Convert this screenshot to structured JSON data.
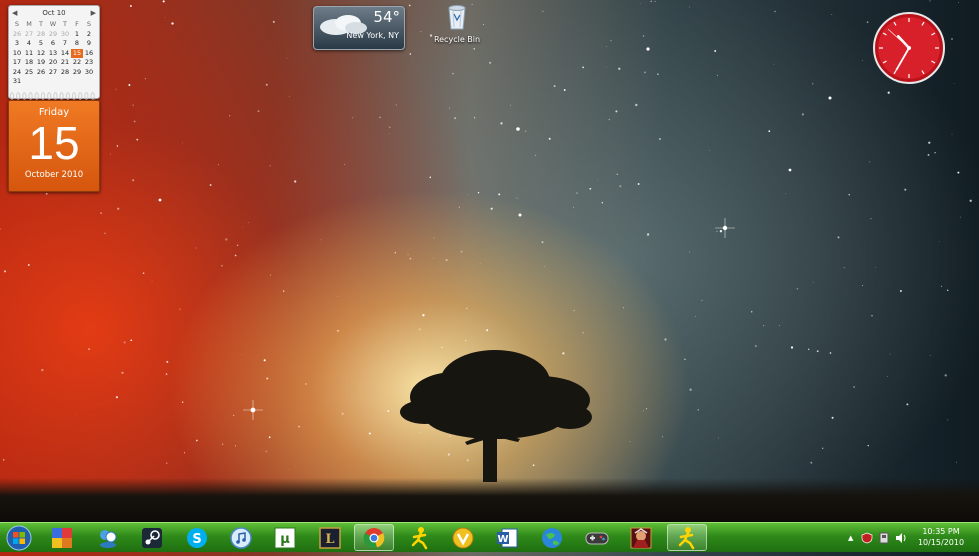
{
  "calendar": {
    "month_label": "Oct 10",
    "prev_label": "◀",
    "next_label": "▶",
    "weekdays": [
      "S",
      "M",
      "T",
      "W",
      "T",
      "F",
      "S"
    ],
    "rows": [
      [
        "26",
        "27",
        "28",
        "29",
        "30",
        "1",
        "2"
      ],
      [
        "3",
        "4",
        "5",
        "6",
        "7",
        "8",
        "9"
      ],
      [
        "10",
        "11",
        "12",
        "13",
        "14",
        "15",
        "16"
      ],
      [
        "17",
        "18",
        "19",
        "20",
        "21",
        "22",
        "23"
      ],
      [
        "24",
        "25",
        "26",
        "27",
        "28",
        "29",
        "30"
      ],
      [
        "31",
        "",
        "",
        "",
        "",
        "",
        ""
      ]
    ],
    "day_name": "Friday",
    "day_number": "15",
    "month_year": "October 2010"
  },
  "weather": {
    "temp": "54°",
    "city": "New York, NY"
  },
  "desktop": {
    "recycle_bin": "Recycle Bin"
  },
  "clock_gadget": {
    "hour": 10,
    "minute": 35,
    "second": 52,
    "face_color": "#d8202a"
  },
  "taskbar": {
    "icons": [
      "windows-start-icon",
      "games-icon",
      "messenger-icon",
      "steam-icon",
      "skype-icon",
      "itunes-icon",
      "utorrent-icon",
      "league-of-legends-icon",
      "chrome-icon",
      "aim-icon",
      "vlc-icon",
      "word-icon",
      "browser-globe-icon",
      "controller-icon",
      "game-hero-icon",
      "aim-icon"
    ],
    "time": "10:35 PM",
    "date": "10/15/2010",
    "colors": {
      "bar": "#2f8a1a",
      "accent": "#9fe07a"
    }
  }
}
